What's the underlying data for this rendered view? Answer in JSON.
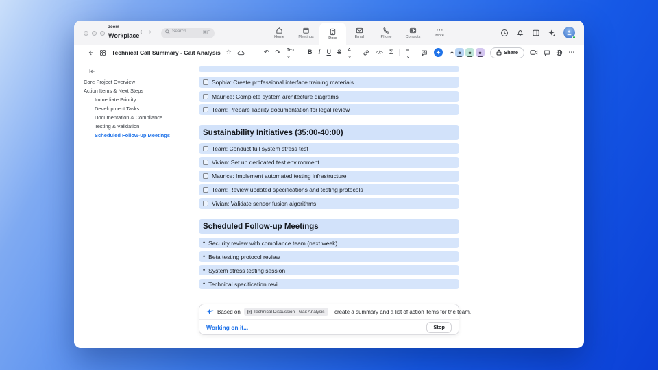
{
  "colors": {
    "accent_blue": "#2073e8",
    "row_bg": "#d6e5fb",
    "heading_bg": "#d2e2fa",
    "desktop_blue": "#1659e6",
    "presence_green": "#22b24c"
  },
  "topbar": {
    "logo_top": "zoom",
    "logo_bottom": "Workplace",
    "back_glyph": "‹",
    "forward_glyph": "›",
    "search": {
      "placeholder": "Search",
      "shortcut": "⌘F"
    },
    "tabs": [
      {
        "label": "Home"
      },
      {
        "label": "Meetings"
      },
      {
        "label": "Docs"
      },
      {
        "label": "Email"
      },
      {
        "label": "Phone"
      },
      {
        "label": "Contacts"
      },
      {
        "label": "More"
      }
    ],
    "more_glyph": "⋯"
  },
  "docbar": {
    "title": "Technical Call Summary - Gait Analysis",
    "star_glyph": "☆",
    "undo_glyph": "↶",
    "redo_glyph": "↷",
    "text_style": "Text",
    "dropdown_glyph": "⌄",
    "bold_glyph": "B",
    "italic_glyph": "I",
    "underline_glyph": "U",
    "strike_glyph": "S",
    "color_glyph": "A",
    "code_glyph": "</>",
    "formula_glyph": "Σ",
    "align_glyph": "≡",
    "share_label": "Share",
    "more_glyph": "⋯"
  },
  "sidebar": {
    "items": [
      {
        "label": "Core Project Overview"
      },
      {
        "label": "Action Items & Next Steps"
      },
      {
        "label": "Immediate Priority"
      },
      {
        "label": "Development Tasks"
      },
      {
        "label": "Documentation & Compliance"
      },
      {
        "label": "Testing & Validation"
      },
      {
        "label": "Scheduled Follow-up Meetings"
      }
    ]
  },
  "document": {
    "checklist_top": [
      "Sophia: Create professional interface training materials",
      "Maurice: Complete system architecture diagrams",
      "Team: Prepare liability documentation for legal review"
    ],
    "section1": {
      "heading": "Sustainability Initiatives (35:00-40:00)",
      "items": [
        "Team: Conduct full system stress test",
        "Vivian: Set up dedicated test environment",
        "Maurice: Implement automated testing infrastructure",
        "Team: Review updated specifications and testing protocols",
        "Vivian: Validate sensor fusion algorithms"
      ]
    },
    "section2": {
      "heading": "Scheduled Follow-up Meetings",
      "bullet_glyph": "•",
      "bullets": [
        "Security review with compliance team (next week)",
        "Beta testing protocol review",
        "System stress testing session",
        "Technical specification revi"
      ]
    }
  },
  "ai_panel": {
    "prefix": "Based on",
    "chip_label": "Technical Discussion - Gait Analysis",
    "suffix": ", create a summary and a list of action items for the team.",
    "status": "Working on it...",
    "stop_label": "Stop"
  }
}
